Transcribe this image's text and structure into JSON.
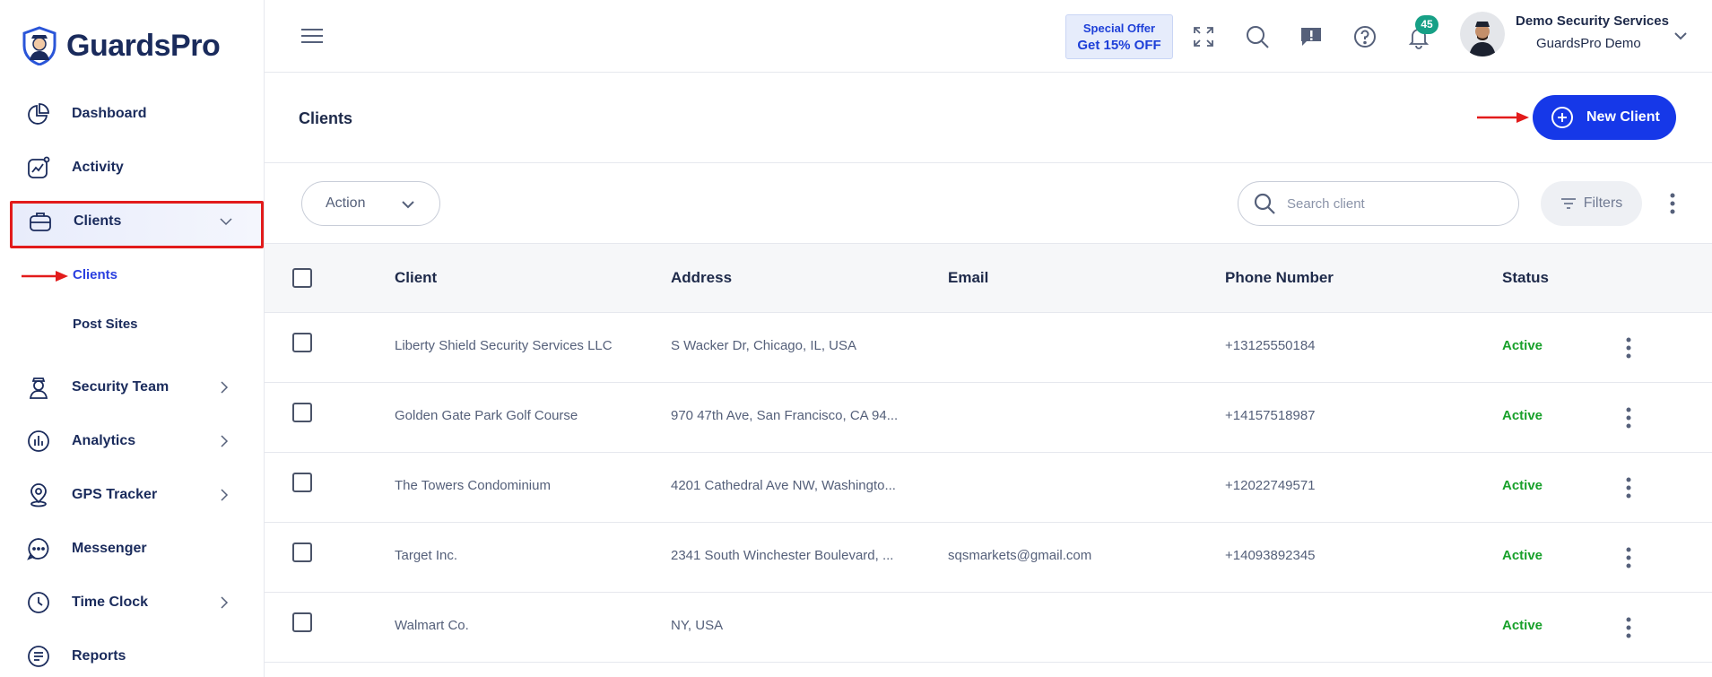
{
  "brand": {
    "name": "GuardsPro"
  },
  "sidebar": {
    "items": [
      {
        "label": "Dashboard",
        "icon": "pie-chart-icon"
      },
      {
        "label": "Activity",
        "icon": "activity-chart-icon"
      },
      {
        "label": "Clients",
        "icon": "briefcase-icon",
        "expanded": true
      },
      {
        "label": "Security Team",
        "icon": "guard-icon"
      },
      {
        "label": "Analytics",
        "icon": "analytics-icon"
      },
      {
        "label": "GPS Tracker",
        "icon": "location-pin-icon"
      },
      {
        "label": "Messenger",
        "icon": "chat-bubble-icon"
      },
      {
        "label": "Time Clock",
        "icon": "clock-icon"
      },
      {
        "label": "Reports",
        "icon": "document-icon"
      }
    ],
    "subitems": [
      {
        "label": "Clients",
        "active": true
      },
      {
        "label": "Post Sites",
        "active": false
      }
    ]
  },
  "header": {
    "offer_top": "Special Offer",
    "offer_bottom": "Get 15% OFF",
    "notification_count": "45",
    "user_name": "Demo Security Services",
    "user_org": "GuardsPro Demo"
  },
  "page": {
    "title": "Clients",
    "new_button": "New Client"
  },
  "toolbar": {
    "action_label": "Action",
    "search_placeholder": "Search client",
    "filters_label": "Filters"
  },
  "table": {
    "columns": [
      "Client",
      "Address",
      "Email",
      "Phone Number",
      "Status"
    ],
    "rows": [
      {
        "client": "Liberty Shield Security Services LLC",
        "address": "S Wacker Dr, Chicago, IL, USA",
        "email": "",
        "phone": "+13125550184",
        "status": "Active"
      },
      {
        "client": "Golden Gate Park Golf Course",
        "address": "970 47th Ave, San Francisco, CA 94...",
        "email": "",
        "phone": "+14157518987",
        "status": "Active"
      },
      {
        "client": "The Towers Condominium",
        "address": "4201 Cathedral Ave NW, Washingto...",
        "email": "",
        "phone": "+12022749571",
        "status": "Active"
      },
      {
        "client": "Target Inc.",
        "address": "2341 South Winchester Boulevard, ...",
        "email": "sqsmarkets@gmail.com",
        "phone": "+14093892345",
        "status": "Active"
      },
      {
        "client": "Walmart Co.",
        "address": "NY, USA",
        "email": "",
        "phone": "",
        "status": "Active"
      }
    ]
  },
  "colors": {
    "accent": "#1638e8",
    "active_status": "#17a02a",
    "highlight_border": "#e21b1b",
    "notification_badge": "#17a086"
  }
}
